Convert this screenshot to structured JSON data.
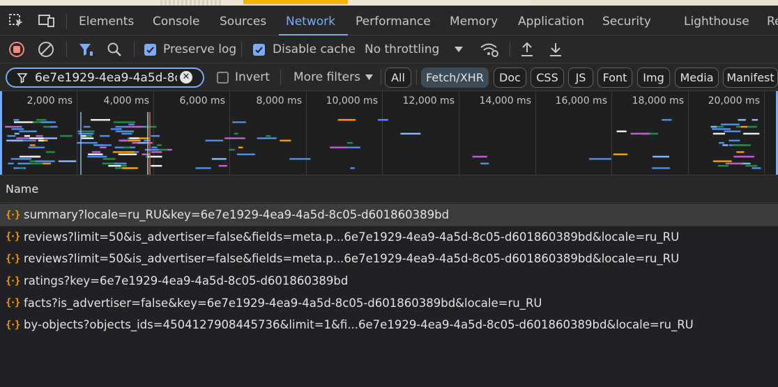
{
  "tabs": [
    "Elements",
    "Console",
    "Sources",
    "Network",
    "Performance",
    "Memory",
    "Application",
    "Security",
    "Lighthouse",
    "Re"
  ],
  "active_tab": "Network",
  "toolbar": {
    "preserve_log": "Preserve log",
    "disable_cache": "Disable cache",
    "throttling": "No throttling"
  },
  "filter": {
    "value": "6e7e1929-4ea9-4a5d-8c",
    "invert": "Invert",
    "more_filters": "More filters",
    "types": [
      "All",
      "Fetch/XHR",
      "Doc",
      "CSS",
      "JS",
      "Font",
      "Img",
      "Media",
      "Manifest"
    ],
    "selected_type": "Fetch/XHR"
  },
  "overview": {
    "ticks": [
      "2,000 ms",
      "4,000 ms",
      "6,000 ms",
      "8,000 ms",
      "10,000 ms",
      "12,000 ms",
      "14,000 ms",
      "16,000 ms",
      "18,000 ms",
      "20,000 ms"
    ]
  },
  "table": {
    "column_name": "Name",
    "rows": [
      "summary?locale=ru_RU&key=6e7e1929-4ea9-4a5d-8c05-d601860389bd",
      "reviews?limit=50&is_advertiser=false&fields=meta.p...6e7e1929-4ea9-4a5d-8c05-d601860389bd&locale=ru_RU",
      "reviews?limit=50&is_advertiser=false&fields=meta.p...6e7e1929-4ea9-4a5d-8c05-d601860389bd&locale=ru_RU",
      "ratings?key=6e7e1929-4ea9-4a5d-8c05-d601860389bd",
      "facts?is_advertiser=false&key=6e7e1929-4ea9-4a5d-8c05-d601860389bd&locale=ru_RU",
      "by-objects?objects_ids=4504127908445736&limit=1&fi...6e7e1929-4ea9-4a5d-8c05-d601860389bd&locale=ru_RU"
    ],
    "selected_row": 0
  },
  "colors": {
    "accent": "#7cacf8",
    "record_red": "#f28b82",
    "xhr_icon": "#f29900"
  }
}
